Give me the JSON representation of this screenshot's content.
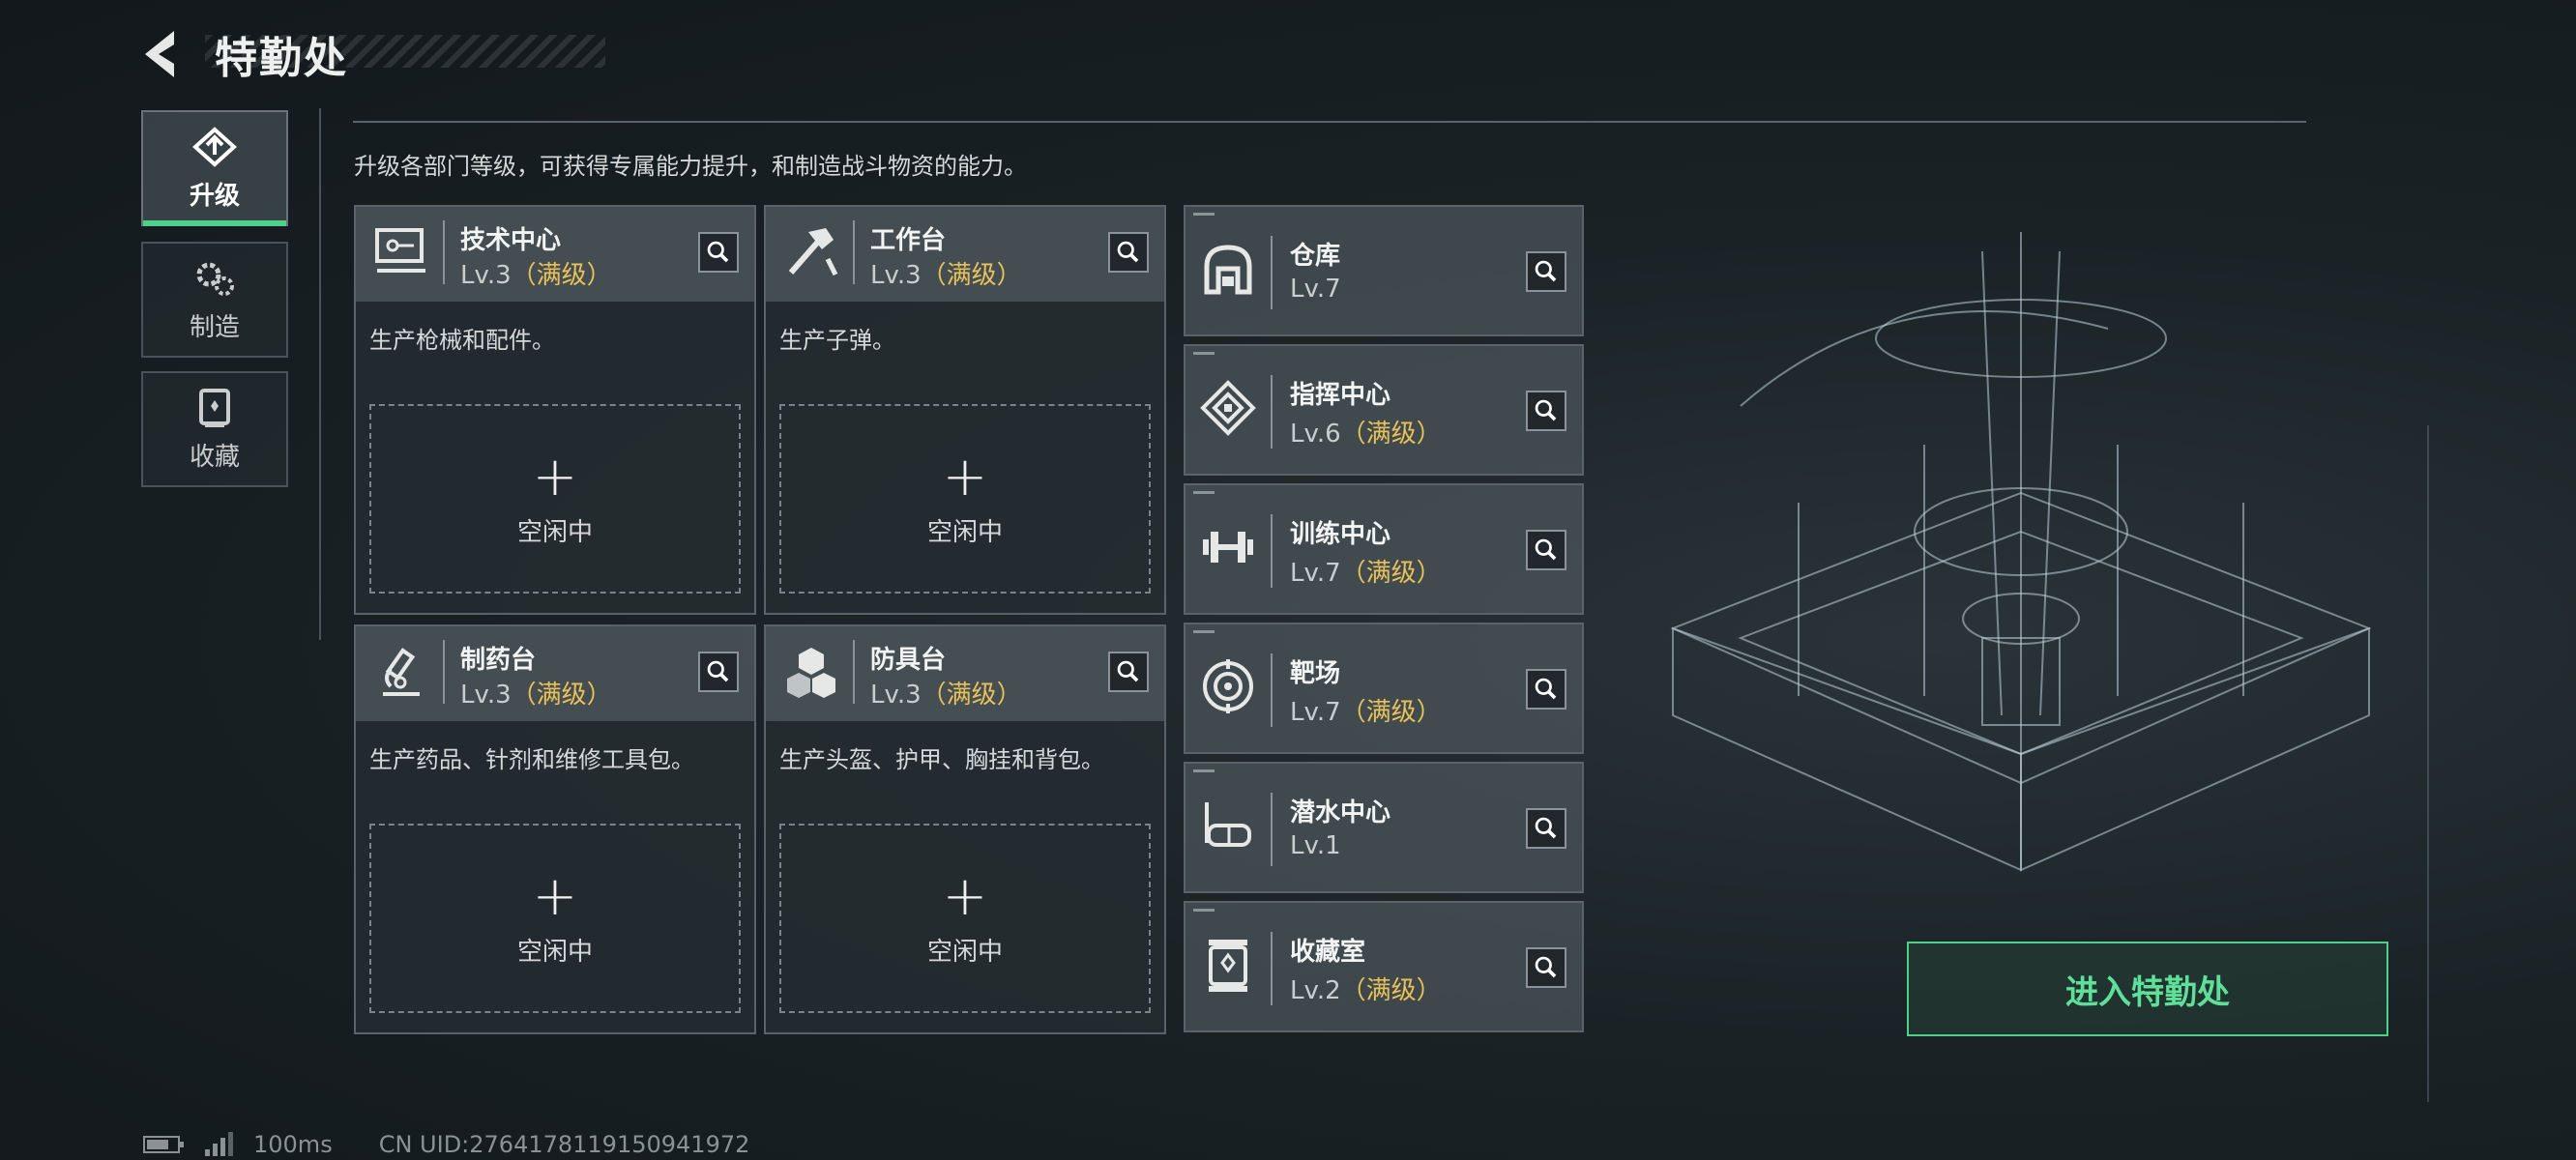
{
  "header": {
    "title": "特勤处"
  },
  "tabs": [
    {
      "label": "升级",
      "icon": "upgrade-icon",
      "active": true
    },
    {
      "label": "制造",
      "icon": "gears-icon",
      "active": false
    },
    {
      "label": "收藏",
      "icon": "collection-icon",
      "active": false
    }
  ],
  "description": "升级各部门等级，可获得专属能力提升，和制造战斗物资的能力。",
  "departments": [
    {
      "name": "技术中心",
      "level": "Lv.3",
      "max": "（满级）",
      "desc": "生产枪械和配件。",
      "slot": "空闲中",
      "icon": "tech-center-icon"
    },
    {
      "name": "工作台",
      "level": "Lv.3",
      "max": "（满级）",
      "desc": "生产子弹。",
      "slot": "空闲中",
      "icon": "workbench-icon"
    },
    {
      "name": "制药台",
      "level": "Lv.3",
      "max": "（满级）",
      "desc": "生产药品、针剂和维修工具包。",
      "slot": "空闲中",
      "icon": "pharmacy-icon"
    },
    {
      "name": "防具台",
      "level": "Lv.3",
      "max": "（满级）",
      "desc": "生产头盔、护甲、胸挂和背包。",
      "slot": "空闲中",
      "icon": "armor-bench-icon"
    }
  ],
  "facilities": [
    {
      "name": "仓库",
      "level": "Lv.7",
      "max": "",
      "icon": "warehouse-icon"
    },
    {
      "name": "指挥中心",
      "level": "Lv.6",
      "max": "（满级）",
      "icon": "command-center-icon"
    },
    {
      "name": "训练中心",
      "level": "Lv.7",
      "max": "（满级）",
      "icon": "training-center-icon"
    },
    {
      "name": "靶场",
      "level": "Lv.7",
      "max": "（满级）",
      "icon": "shooting-range-icon"
    },
    {
      "name": "潜水中心",
      "level": "Lv.1",
      "max": "",
      "icon": "diving-center-icon"
    },
    {
      "name": "收藏室",
      "level": "Lv.2",
      "max": "（满级）",
      "icon": "collection-room-icon"
    }
  ],
  "enter_button": "进入特勤处",
  "footer": {
    "ping": "100ms",
    "uid": "CN UID:2764178119150941972"
  },
  "colors": {
    "accent_green": "#4fd08a",
    "max_level_gold": "#e8c15a"
  }
}
